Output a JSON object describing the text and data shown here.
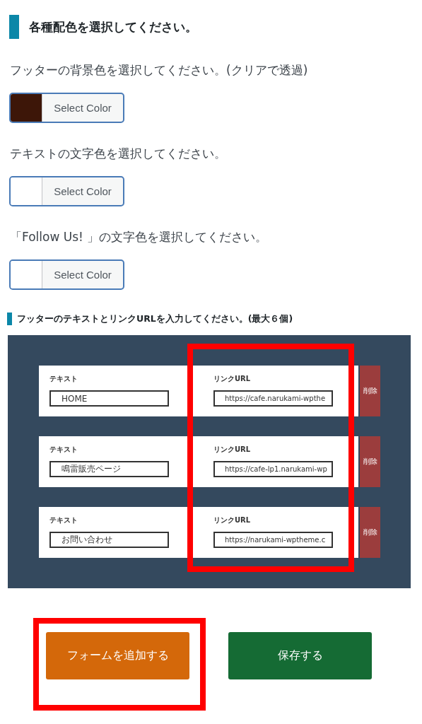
{
  "heading": "各種配色を選択してください。",
  "color_settings": [
    {
      "label": "フッターの背景色を選択してください。(クリアで透過)",
      "button": "Select Color",
      "color": "#3d1608"
    },
    {
      "label": "テキストの文字色を選択してください。",
      "button": "Select Color",
      "color": "#ffffff"
    },
    {
      "label": "「Follow Us! 」の文字色を選択してください。",
      "button": "Select Color",
      "color": "#ffffff"
    }
  ],
  "links_heading": "フッターのテキストとリンクURLを入力してください。(最大６個)",
  "link_rows": [
    {
      "text_label": "テキスト",
      "text_value": "HOME",
      "url_label": "リンクURL",
      "url_value": "https://cafe.narukami-wpthe",
      "delete": "削除"
    },
    {
      "text_label": "テキスト",
      "text_value": "鳴雷販売ページ",
      "url_label": "リンクURL",
      "url_value": "https://cafe-lp1.narukami-wp",
      "delete": "削除"
    },
    {
      "text_label": "テキスト",
      "text_value": "お問い合わせ",
      "url_label": "リンクURL",
      "url_value": "https://narukami-wptheme.c",
      "delete": "削除"
    }
  ],
  "buttons": [
    {
      "label": "フォームを追加する",
      "kind": "add",
      "highlighted": true
    },
    {
      "label": "保存する",
      "kind": "save",
      "highlighted": false
    }
  ],
  "url_column_highlighted": true
}
